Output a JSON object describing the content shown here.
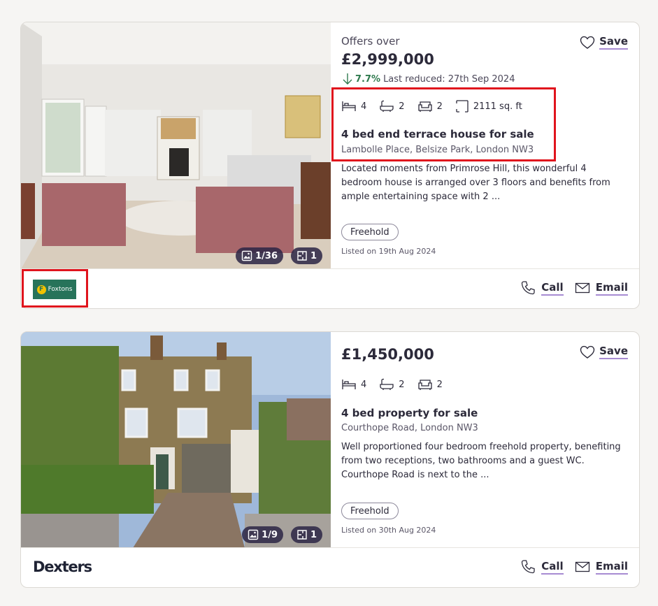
{
  "listings": [
    {
      "price_qualifier": "Offers over",
      "price": "£2,999,000",
      "reduction": {
        "percent": "7.7%",
        "text": "Last reduced: 27th Sep 2024"
      },
      "save_label": "Save",
      "features": {
        "beds": "4",
        "baths": "2",
        "receptions": "2",
        "area": "2111 sq. ft"
      },
      "title": "4 bed end terrace house for sale",
      "address": "Lambolle Place, Belsize Park, London NW3",
      "description": "Located moments from Primrose Hill, this wonderful 4 bedroom house is arranged over 3 floors and benefits from ample entertaining space with 2 ...",
      "tenure": "Freehold",
      "listed": "Listed on 19th Aug 2024",
      "photo_count": "1/36",
      "floorplan_count": "1",
      "agent": "Foxtons",
      "call_label": "Call",
      "email_label": "Email"
    },
    {
      "price": "£1,450,000",
      "save_label": "Save",
      "features": {
        "beds": "4",
        "baths": "2",
        "receptions": "2"
      },
      "title": "4 bed property for sale",
      "address": "Courthope Road, London NW3",
      "description": "Well proportioned four bedroom freehold property, benefiting from two receptions, two bathrooms and a guest WC. Courthope Road is next to the ...",
      "tenure": "Freehold",
      "listed": "Listed on 30th Aug 2024",
      "photo_count": "1/9",
      "floorplan_count": "1",
      "agent": "Dexters",
      "call_label": "Call",
      "email_label": "Email"
    }
  ],
  "colors": {
    "highlight": "#e0141d",
    "accent_underline": "#a78bd2",
    "reduction": "#2f7a4e",
    "foxtons_green": "#27735a"
  }
}
